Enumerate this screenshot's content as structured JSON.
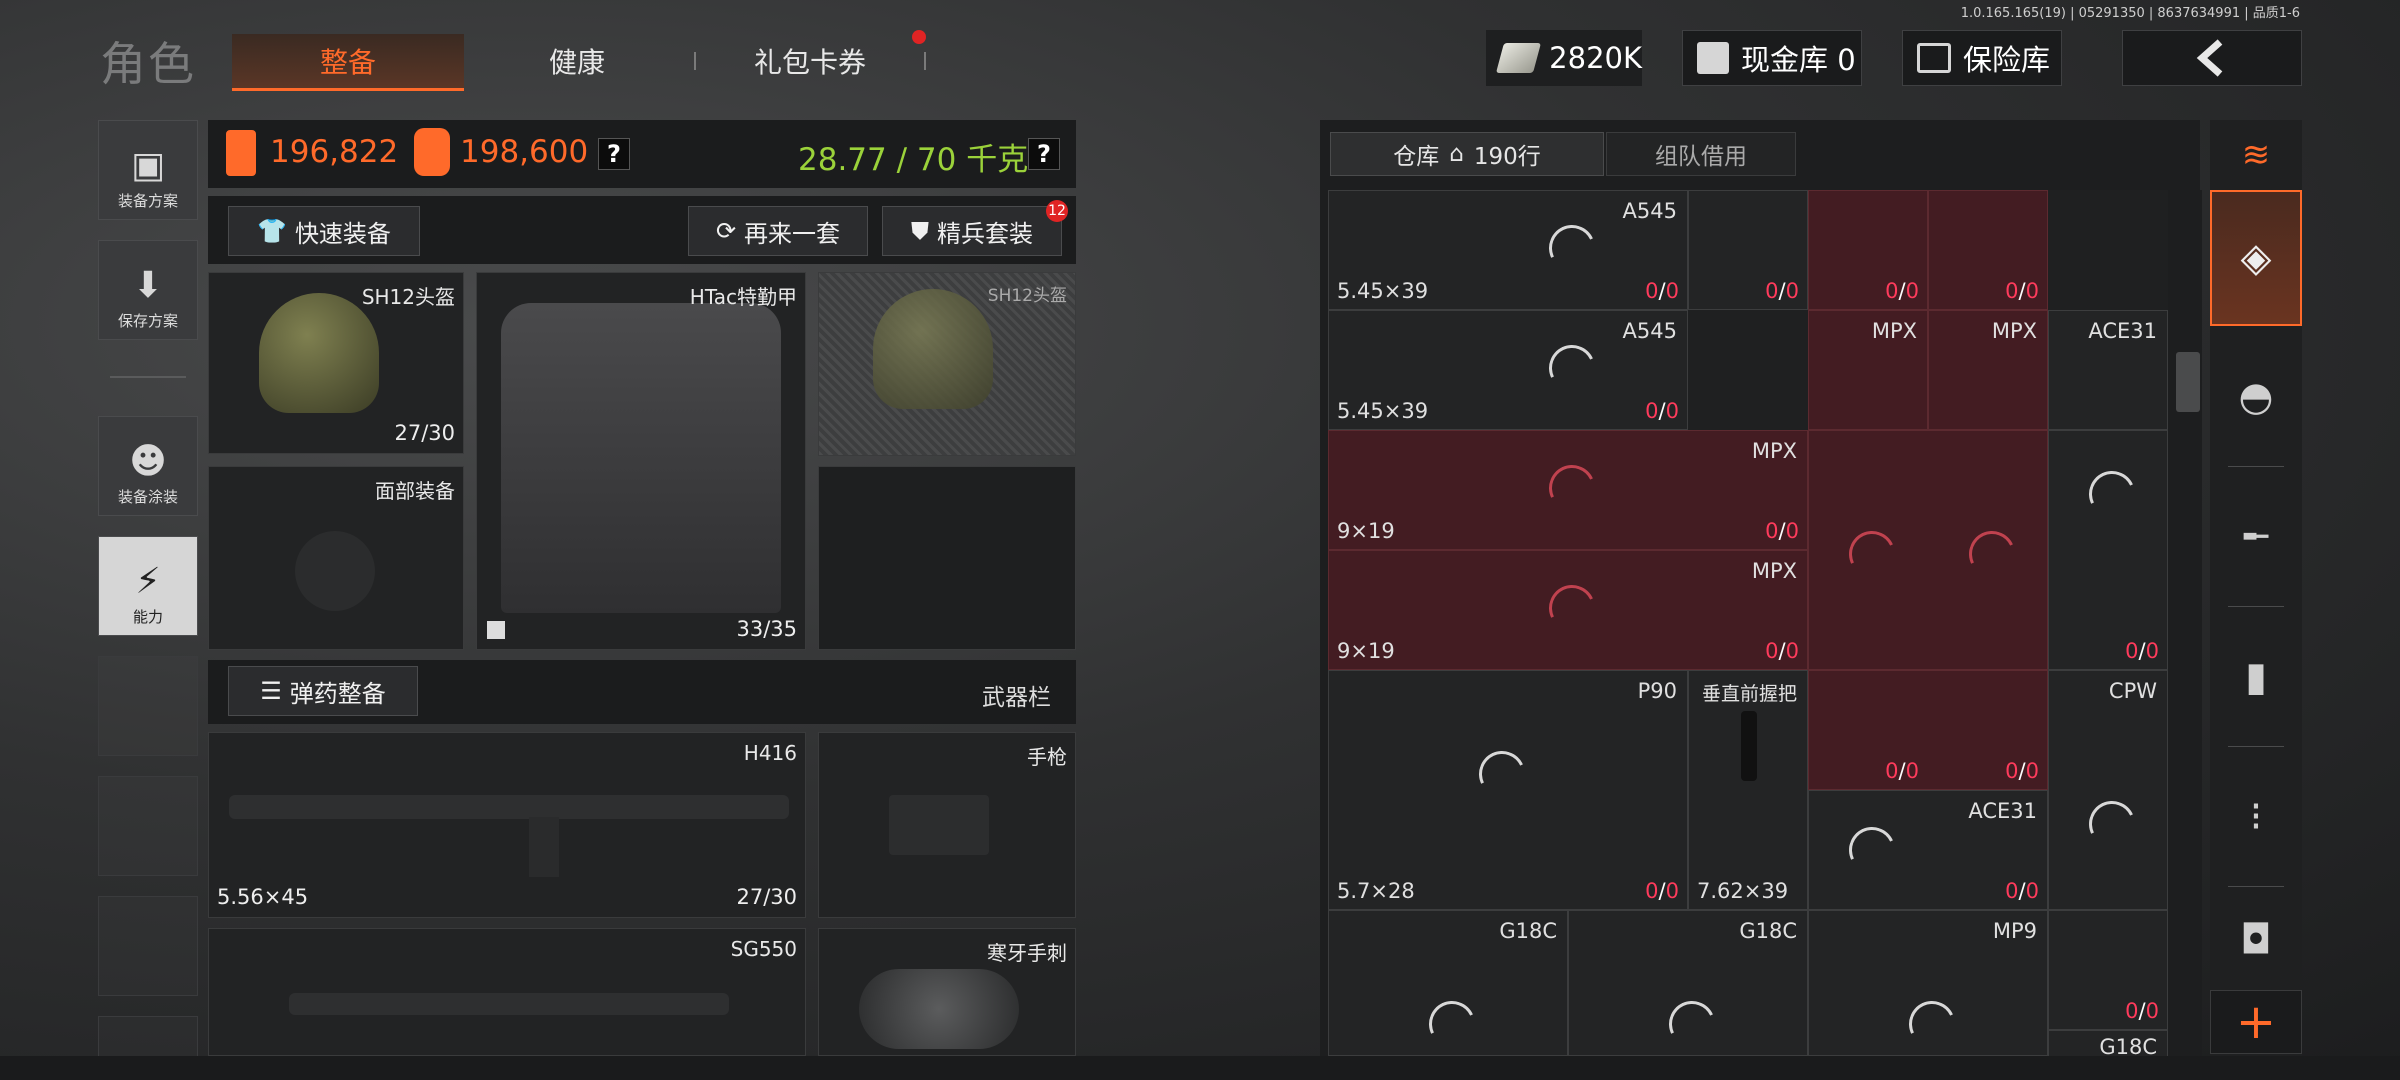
{
  "version": "1.0.165.165(19) | 05291350 | 8637634991 | 品质1-6",
  "header": {
    "title": "角色",
    "tabs": [
      {
        "label": "整备",
        "active": true
      },
      {
        "label": "健康",
        "active": false
      },
      {
        "label": "礼包卡券",
        "active": false
      }
    ],
    "money": "2820K",
    "cash_vault": "现金库 0",
    "safe_box": "保险库",
    "back_icon": "chevron-left-icon"
  },
  "sidebar": {
    "items": [
      {
        "label": "装备方案",
        "icon": "vest-icon"
      },
      {
        "label": "保存方案",
        "icon": "download-icon"
      },
      {
        "label": "装备涂装",
        "icon": "mask-icon"
      },
      {
        "label": "能力",
        "icon": "lightning-icon"
      }
    ]
  },
  "loadout": {
    "value_1": "196,822",
    "value_2": "198,600",
    "weight": "28.77 / 70 千克",
    "help": "?",
    "quick_equip": "快速装备",
    "again": "再来一套",
    "elite_set": "精兵套装",
    "elite_badge": "12",
    "slots": {
      "helmet_name": "SH12头盔",
      "helmet_dur": "27/30",
      "armor_name": "HTac特勤甲",
      "armor_dur": "33/35",
      "helmet2_name": "SH12头盔",
      "face_name": "面部装备"
    },
    "ammo_equip": "弹药整备",
    "weapon_bar": "武器栏",
    "weapons": {
      "primary_name": "H416",
      "primary_cal": "5.56×45",
      "primary_dur": "27/30",
      "pistol_name": "手枪",
      "secondary_name": "SG550",
      "melee_name": "寒牙手刺"
    }
  },
  "warehouse": {
    "tab_label": "仓库",
    "tab_count": "190行",
    "team_tab": "组队借用",
    "cells": [
      {
        "name": "A545",
        "cal": "5.45×39",
        "cnt_a": "0",
        "cnt_b": "0"
      },
      {
        "name": "",
        "cal": "",
        "cnt_a": "0",
        "cnt_b": "0"
      },
      {
        "name": "",
        "cal": "",
        "cnt_a": "0",
        "cnt_b": "0"
      },
      {
        "name": "",
        "cal": "",
        "cnt_a": "0",
        "cnt_b": "0"
      },
      {
        "name": "A545",
        "cal": "5.45×39",
        "cnt_a": "0",
        "cnt_b": "0"
      },
      {
        "name": "MPX",
        "cal": "",
        "cnt_a": "",
        "cnt_b": ""
      },
      {
        "name": "MPX",
        "cal": "",
        "cnt_a": "",
        "cnt_b": ""
      },
      {
        "name": "ACE31",
        "cal": "",
        "cnt_a": "",
        "cnt_b": ""
      },
      {
        "name": "MPX",
        "cal": "9×19",
        "cnt_a": "0",
        "cnt_b": "0"
      },
      {
        "name": "MPX",
        "cal": "9×19",
        "cnt_a": "0",
        "cnt_b": "0"
      },
      {
        "name": "",
        "cal": "",
        "cnt_a": "0",
        "cnt_b": "0"
      },
      {
        "name": "P90",
        "cal": "",
        "cnt_a": "",
        "cnt_b": ""
      },
      {
        "name": "垂直前握把",
        "cal": "",
        "cnt_a": "0",
        "cnt_b": "0"
      },
      {
        "name": "",
        "cal": "",
        "cnt_a": "0",
        "cnt_b": "0"
      },
      {
        "name": "CPW",
        "cal": "",
        "cnt_a": "",
        "cnt_b": ""
      },
      {
        "name": "",
        "cal": "5.7×28",
        "cnt_a": "0",
        "cnt_b": "0"
      },
      {
        "name": "",
        "cal": "7.62×39",
        "cnt_a": "",
        "cnt_b": ""
      },
      {
        "name": "ACE31",
        "cal": "",
        "cnt_a": "0",
        "cnt_b": "0"
      },
      {
        "name": "G18C",
        "cal": "",
        "cnt_a": "",
        "cnt_b": ""
      },
      {
        "name": "G18C",
        "cal": "",
        "cnt_a": "",
        "cnt_b": ""
      },
      {
        "name": "MP9",
        "cal": "",
        "cnt_a": "",
        "cnt_b": ""
      },
      {
        "name": "",
        "cal": "",
        "cnt_a": "0",
        "cnt_b": "0"
      },
      {
        "name": "G18C",
        "cal": "",
        "cnt_a": "",
        "cnt_b": ""
      }
    ]
  },
  "rail": {
    "items": [
      "layers-refresh-icon",
      "layers-icon",
      "helmet-icon",
      "rifle-icon",
      "magazine-icon",
      "ammo-icon",
      "scope-icon",
      "plus-icon"
    ]
  },
  "colors": {
    "accent": "#ff6a2a",
    "warning_red": "#ff3b5c",
    "weight_green": "#9bd23a",
    "red_cell": "#431c22"
  }
}
